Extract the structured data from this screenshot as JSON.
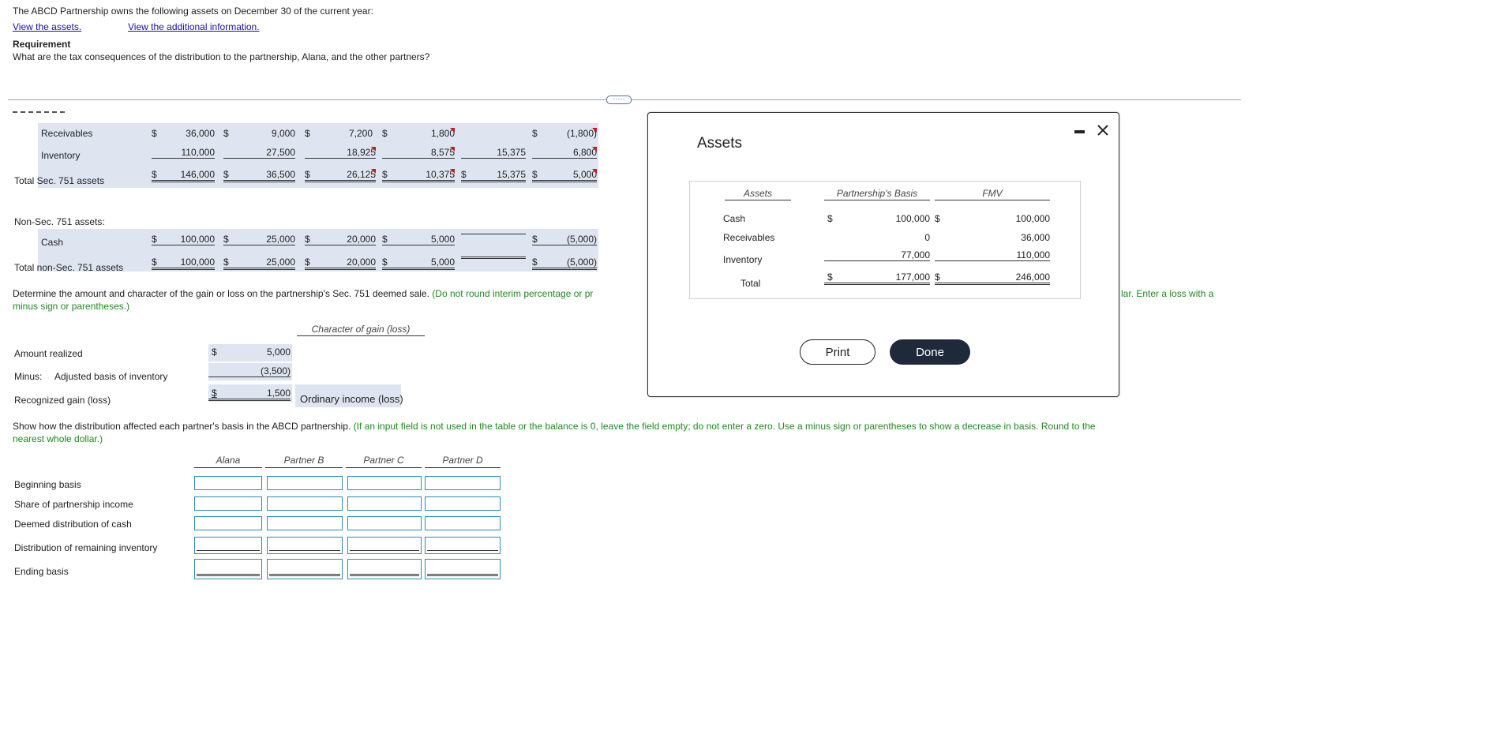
{
  "intro": {
    "line1": "The ABCD Partnership owns the following assets on December 30 of the current year:",
    "link_assets": "View the assets.",
    "link_additional": "View the additional information.",
    "req_heading": "Requirement",
    "req_text": "What are the tax consequences of the distribution to the partnership, Alana, and the other partners?"
  },
  "divider_handle": "·····",
  "sec751": {
    "receivables": {
      "label": "Receivables",
      "c1": "36,000",
      "c2": "9,000",
      "c3": "7,200",
      "c4": "1,800",
      "c5": "",
      "c6": "(1,800)"
    },
    "inventory": {
      "label": "Inventory",
      "c1": "110,000",
      "c2": "27,500",
      "c3": "18,925",
      "c4": "8,575",
      "c5": "15,375",
      "c6": "6,800"
    },
    "total": {
      "label": "Total Sec. 751 assets",
      "c1": "146,000",
      "c2": "36,500",
      "c3": "26,125",
      "c4": "10,375",
      "c5": "15,375",
      "c6": "5,000"
    }
  },
  "nonsec": {
    "heading": "Non-Sec. 751 assets:",
    "cash": {
      "label": "Cash",
      "c1": "100,000",
      "c2": "25,000",
      "c3": "20,000",
      "c4": "5,000",
      "c5": "",
      "c6": "(5,000)"
    },
    "total": {
      "label": "Total non-Sec. 751 assets",
      "c1": "100,000",
      "c2": "25,000",
      "c3": "20,000",
      "c4": "5,000",
      "c5": "",
      "c6": "(5,000)"
    }
  },
  "dollar": "$",
  "q1": {
    "text": "Determine the amount and character of the gain or loss on the partnership's Sec. 751 deemed sale.",
    "note_a": "(Do not round interim percentage or pr",
    "note_b": "lar. Enter a loss with a",
    "note_line2": "minus sign or parentheses.)"
  },
  "gain": {
    "char_header": "Character of gain (loss)",
    "amount_label": "Amount realized",
    "amount_value": "5,000",
    "minus_label": "Minus:",
    "basis_label": "Adjusted basis of inventory",
    "basis_value": "(3,500)",
    "recognized_label": "Recognized gain (loss)",
    "recognized_value": "1,500",
    "character": "Ordinary income (loss)"
  },
  "q2": {
    "text": "Show how the distribution affected each partner's basis in the ABCD partnership.",
    "note": "(If an input field is not used in the table or the balance is 0, leave the field empty; do not enter a zero. Use a minus sign or parentheses to show a decrease in basis. Round to the",
    "note_line2": "nearest whole dollar.)"
  },
  "basis_table": {
    "headers": [
      "Alana",
      "Partner B",
      "Partner C",
      "Partner D"
    ],
    "rows": [
      "Beginning basis",
      "Share of partnership income",
      "Deemed distribution of cash",
      "Distribution of remaining inventory",
      "Ending basis"
    ]
  },
  "modal": {
    "title": "Assets",
    "col_assets": "Assets",
    "col_basis": "Partnership's Basis",
    "col_fmv": "FMV",
    "rows": [
      {
        "label": "Cash",
        "basis": "100,000",
        "fmv": "100,000"
      },
      {
        "label": "Receivables",
        "basis": "0",
        "fmv": "36,000"
      },
      {
        "label": "Inventory",
        "basis": "77,000",
        "fmv": "110,000"
      }
    ],
    "total_label": "Total",
    "total_basis": "177,000",
    "total_fmv": "246,000",
    "print_label": "Print",
    "done_label": "Done",
    "minimize_icon": "minimize-icon",
    "close_icon": "close-icon"
  }
}
